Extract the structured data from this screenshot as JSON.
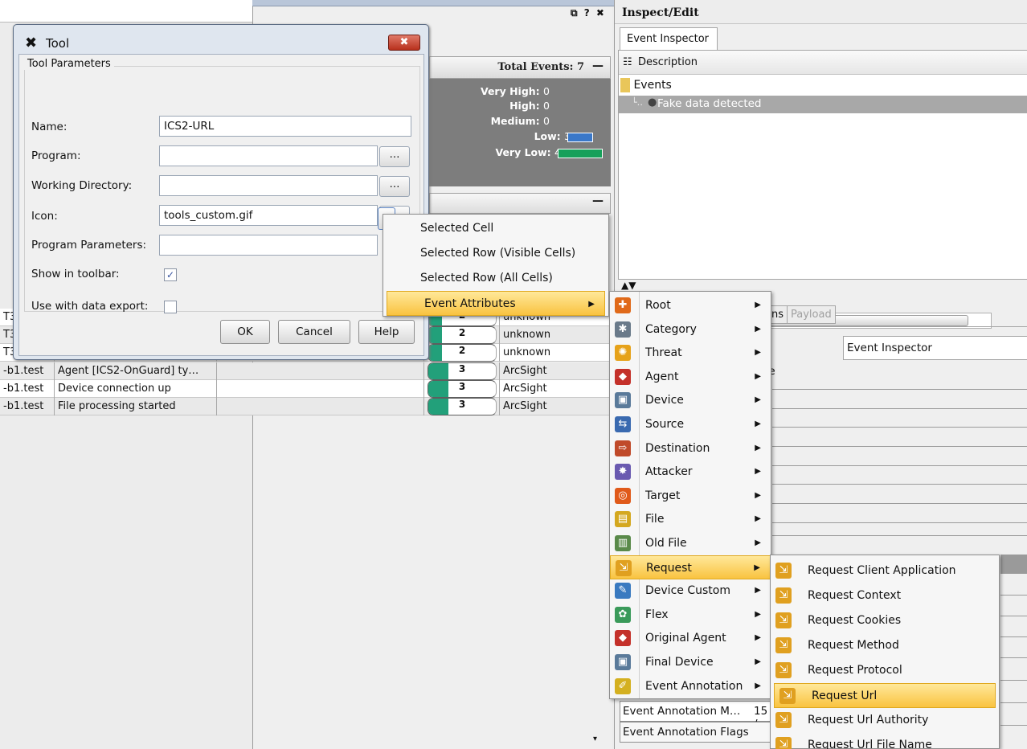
{
  "mid_panel": {
    "window_controls": "⧉ ? ✖",
    "total_events_label": "Total Events: 7",
    "collapse_symbol": "—",
    "severity": [
      {
        "label": "Very High:",
        "count": "0"
      },
      {
        "label": "High:",
        "count": "0"
      },
      {
        "label": "Medium:",
        "count": "0"
      },
      {
        "label": "Low:",
        "count": "3"
      },
      {
        "label": "Very Low:",
        "count": "4"
      }
    ],
    "severity_colors": {
      "low": "#3a78c9",
      "very_low": "#16a05a"
    }
  },
  "events_table": {
    "rows": [
      {
        "host": "T3",
        "name": "",
        "priority": "2",
        "priority_fraction": 0.2,
        "vendor": "unknown"
      },
      {
        "host": "T3",
        "name": "",
        "priority": "2",
        "priority_fraction": 0.2,
        "vendor": "unknown"
      },
      {
        "host": "T3",
        "name": "",
        "priority": "2",
        "priority_fraction": 0.2,
        "vendor": "unknown"
      },
      {
        "host": "-b1.test",
        "name": "Agent [ICS2-OnGuard] ty…",
        "priority": "3",
        "priority_fraction": 0.3,
        "vendor": "ArcSight"
      },
      {
        "host": "-b1.test",
        "name": "Device connection up",
        "priority": "3",
        "priority_fraction": 0.3,
        "vendor": "ArcSight"
      },
      {
        "host": "-b1.test",
        "name": "File processing started",
        "priority": "3",
        "priority_fraction": 0.3,
        "vendor": "ArcSight"
      }
    ]
  },
  "tool_dialog": {
    "title": "Tool",
    "close_label": "✖",
    "group_label": "Tool Parameters",
    "fields": {
      "name_label": "Name:",
      "name_value": "ICS2-URL",
      "program_label": "Program:",
      "program_value": "",
      "workdir_label": "Working Directory:",
      "workdir_value": "",
      "icon_label": "Icon:",
      "icon_value": "tools_custom.gif",
      "params_label": "Program Parameters:",
      "params_value": "",
      "toolbar_label": "Show in toolbar:",
      "toolbar_checked": true,
      "export_label": "Use with data export:",
      "export_checked": false
    },
    "browse_label": "…",
    "buttons": {
      "ok": "OK",
      "cancel": "Cancel",
      "help": "Help"
    }
  },
  "param_menu": {
    "items": [
      "Selected Cell",
      "Selected Row (Visible Cells)",
      "Selected Row (All Cells)",
      "Event Attributes"
    ]
  },
  "attr_menu": {
    "items": [
      "Root",
      "Category",
      "Threat",
      "Agent",
      "Device",
      "Source",
      "Destination",
      "Attacker",
      "Target",
      "File",
      "Old File",
      "Request",
      "Device Custom",
      "Flex",
      "Original Agent",
      "Final Device",
      "Event Annotation"
    ]
  },
  "request_menu": {
    "items": [
      "Request Client Application",
      "Request Context",
      "Request Cookies",
      "Request Method",
      "Request Protocol",
      "Request Url",
      "Request Url Authority",
      "Request Url File Name"
    ]
  },
  "inspector": {
    "title": "Inspect/Edit",
    "tab": "Event Inspector",
    "description_header": "Description",
    "events_node": "Events",
    "event_item": "Fake data detected",
    "scroll_thumb": "III",
    "lower_tabs": [
      "ns",
      "Payload"
    ],
    "inspector_field": "Event Inspector",
    "column_header": "ie",
    "annotation_row1": "Event Annotation M…",
    "annotation_row1_value": "15 /",
    "annotation_row2": "Event Annotation Flags"
  },
  "icons": {
    "tool": "pin-icon",
    "attr_colors": {
      "root": "#e06a1a",
      "category": "#6a7a8a",
      "threat": "#e6a21a",
      "agent": "#c4312a",
      "device": "#5a7a9a",
      "source": "#3a6ab0",
      "destination": "#c04a2a",
      "attacker": "#6a5ab0",
      "target": "#e05a1a",
      "file": "#d4a820",
      "old_file": "#5a8a4a",
      "request": "#e0a020",
      "device_custom": "#3a7ac0",
      "flex": "#3a9a5a",
      "original_agent": "#c4312a",
      "final_device": "#5a7a9a",
      "event_annotation": "#d4b020"
    }
  }
}
